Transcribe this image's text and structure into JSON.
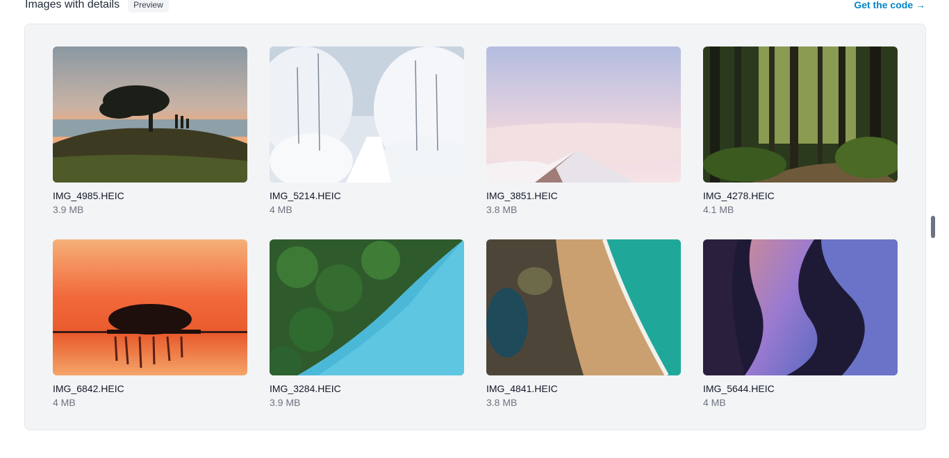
{
  "header": {
    "title": "Images with details",
    "badge": "Preview",
    "code_link": "Get the code →"
  },
  "images": [
    {
      "name": "IMG_4985.HEIC",
      "size": "3.9 MB"
    },
    {
      "name": "IMG_5214.HEIC",
      "size": "4 MB"
    },
    {
      "name": "IMG_3851.HEIC",
      "size": "3.8 MB"
    },
    {
      "name": "IMG_4278.HEIC",
      "size": "4.1 MB"
    },
    {
      "name": "IMG_6842.HEIC",
      "size": "4 MB"
    },
    {
      "name": "IMG_3284.HEIC",
      "size": "3.9 MB"
    },
    {
      "name": "IMG_4841.HEIC",
      "size": "3.8 MB"
    },
    {
      "name": "IMG_5644.HEIC",
      "size": "4 MB"
    }
  ],
  "colors": {
    "accent": "#0284c7",
    "panel_bg": "#f3f4f6",
    "muted_text": "#6b7280"
  }
}
